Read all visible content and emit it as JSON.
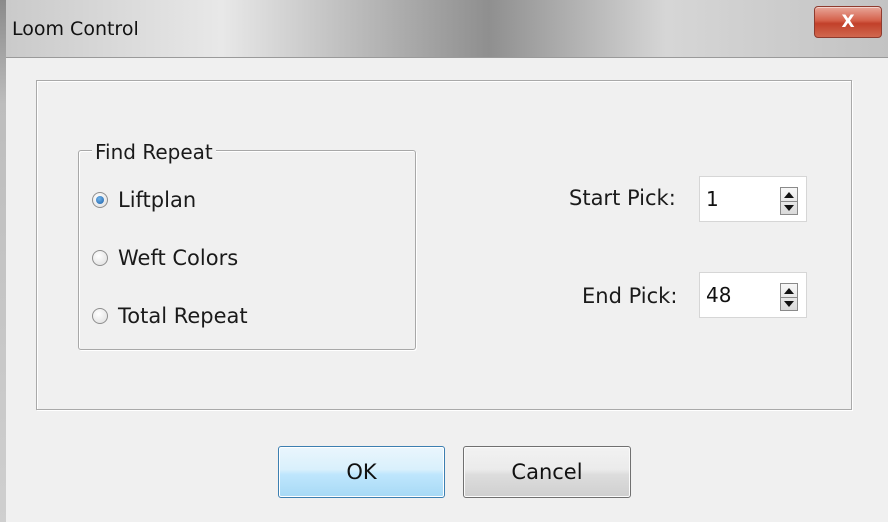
{
  "window": {
    "title": "Loom Control",
    "close_glyph": "X"
  },
  "find_repeat": {
    "legend": "Find Repeat",
    "options": [
      {
        "label": "Liftplan",
        "checked": true
      },
      {
        "label": "Weft Colors",
        "checked": false
      },
      {
        "label": "Total Repeat",
        "checked": false
      }
    ]
  },
  "start_pick": {
    "label": "Start Pick:",
    "value": "1"
  },
  "end_pick": {
    "label": "End Pick:",
    "value": "48"
  },
  "buttons": {
    "ok": "OK",
    "cancel": "Cancel"
  },
  "colors": {
    "close_button": "#c2402a",
    "ok_border": "#3c7fb1",
    "radio_checked": "#1d5fa8",
    "dialog_bg": "#f0f0f0"
  },
  "icons": {
    "close": "close-icon",
    "spin_up": "arrow-up-icon",
    "spin_down": "arrow-down-icon"
  }
}
